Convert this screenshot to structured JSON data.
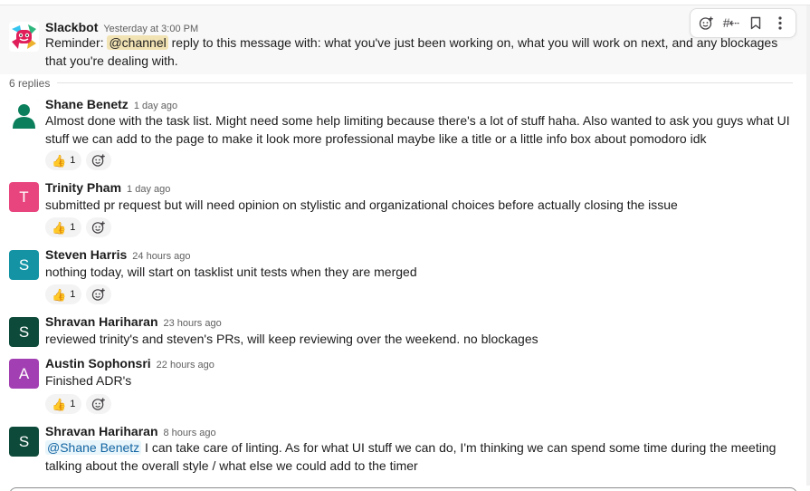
{
  "parent": {
    "author": "Slackbot",
    "time": "Yesterday at 3:00 PM",
    "text_before": "Reminder: ",
    "mention": "@channel",
    "text_after": " reply to this message with: what you've just been working on, what you will work on next, and any blockages that you're dealing with."
  },
  "toolbar": {
    "react_icon": "add-reaction-icon",
    "channel_icon": "share-to-channel-icon",
    "save_icon": "bookmark-icon",
    "more_icon": "more-actions-icon"
  },
  "thread": {
    "replies_label": "6 replies"
  },
  "replies": [
    {
      "author": "Shane Benetz",
      "time": "1 day ago",
      "avatar_letter": "",
      "text": "Almost done with the task list. Might need some help limiting because there's a lot of stuff haha. Also wanted to ask you guys what UI stuff we can add to the page to make it look more professional maybe like a title or a little info box about pomodoro idk",
      "reaction_emoji": "👍",
      "reaction_count": "1"
    },
    {
      "author": "Trinity Pham",
      "time": "1 day ago",
      "avatar_letter": "T",
      "text": "submitted pr request but will need opinion on stylistic and organizational choices before actually closing the issue",
      "reaction_emoji": "👍",
      "reaction_count": "1"
    },
    {
      "author": "Steven Harris",
      "time": "24 hours ago",
      "avatar_letter": "S",
      "text": "nothing today, will start on tasklist unit tests when they are merged",
      "reaction_emoji": "👍",
      "reaction_count": "1"
    },
    {
      "author": "Shravan Hariharan",
      "time": "23 hours ago",
      "avatar_letter": "S",
      "text": "reviewed trinity's and steven's PRs, will keep reviewing over the weekend. no blockages"
    },
    {
      "author": "Austin Sophonsri",
      "time": "22 hours ago",
      "avatar_letter": "A",
      "text": "Finished ADR's",
      "reaction_emoji": "👍",
      "reaction_count": "1"
    },
    {
      "author": "Shravan Hariharan",
      "time": "8 hours ago",
      "avatar_letter": "S",
      "mention": "@Shane Benetz",
      "text": " I can take care of linting. As for what UI stuff we can do, I'm thinking we can spend some time during the meeting talking about the overall style / what else we could add to the timer"
    }
  ],
  "colors": {
    "trinity_avatar": "#e8457e",
    "steven_avatar": "#1393a4",
    "shravan_avatar": "#0e4a3a",
    "austin_avatar": "#a23fb2",
    "shane_avatar_bg": "#dfe9e5",
    "shane_avatar_fg": "#0b7f5b"
  }
}
